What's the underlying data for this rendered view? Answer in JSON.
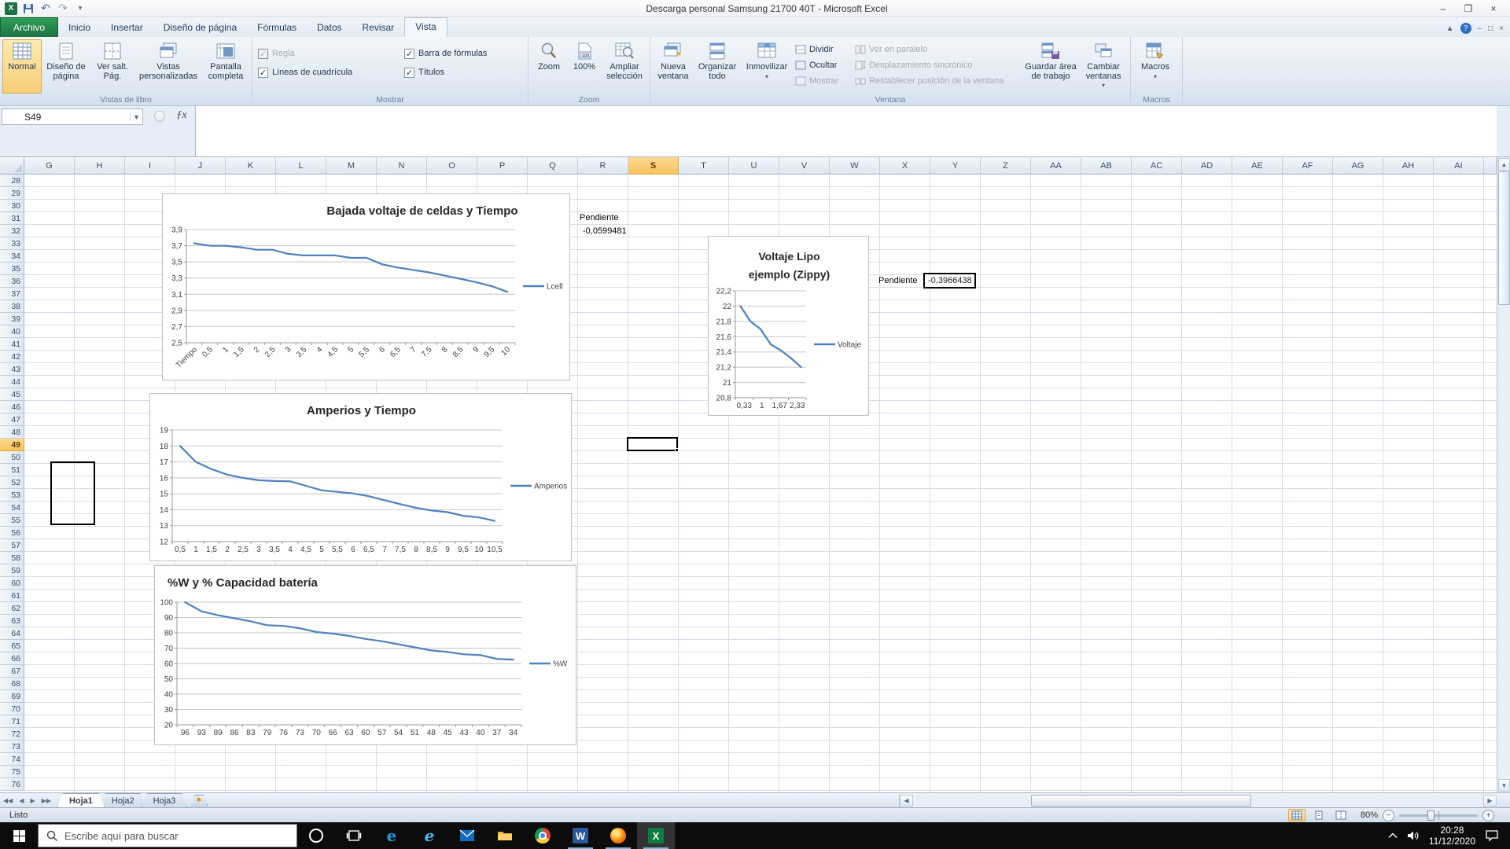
{
  "window": {
    "title": "Descarga personal Samsung 21700 40T - Microsoft Excel"
  },
  "ribbon": {
    "tabs": [
      {
        "label": "Archivo",
        "file": true
      },
      {
        "label": "Inicio"
      },
      {
        "label": "Insertar"
      },
      {
        "label": "Diseño de página"
      },
      {
        "label": "Fórmulas"
      },
      {
        "label": "Datos"
      },
      {
        "label": "Revisar"
      },
      {
        "label": "Vista",
        "active": true
      }
    ],
    "vistas_libro": {
      "label": "Vistas de libro",
      "normal": "Normal",
      "diseno": "Diseño de página",
      "salto": "Ver salt. Pág.",
      "personalizadas": "Vistas personalizadas",
      "pantalla": "Pantalla completa"
    },
    "mostrar": {
      "label": "Mostrar",
      "regla": "Regla",
      "lineas": "Líneas de cuadrícula",
      "barra": "Barra de fórmulas",
      "titulos": "Títulos"
    },
    "zoom": {
      "label": "Zoom",
      "zoom": "Zoom",
      "cien": "100%",
      "ampliar": "Ampliar selección"
    },
    "ventana": {
      "label": "Ventana",
      "nueva": "Nueva ventana",
      "organizar": "Organizar todo",
      "inmovilizar": "Inmovilizar",
      "dividir": "Dividir",
      "ocultar": "Ocultar",
      "mostrar": "Mostrar",
      "paralelo": "Ver en paralelo",
      "desplazamiento": "Desplazamiento sincrónico",
      "restablecer": "Restablecer posición de la ventana",
      "guardar": "Guardar área de trabajo",
      "cambiar": "Cambiar ventanas"
    },
    "macros": {
      "label": "Macros",
      "macros": "Macros"
    }
  },
  "formula_bar": {
    "name_box": "S49",
    "fx": "ƒx"
  },
  "grid": {
    "columns": [
      "G",
      "H",
      "I",
      "J",
      "K",
      "L",
      "M",
      "N",
      "O",
      "P",
      "Q",
      "R",
      "S",
      "T",
      "U",
      "V",
      "W",
      "X",
      "Y",
      "Z",
      "AA",
      "AB",
      "AC",
      "AD",
      "AE",
      "AF",
      "AG",
      "AH",
      "AI"
    ],
    "rows": [
      28,
      29,
      30,
      31,
      32,
      33,
      34,
      35,
      36,
      37,
      38,
      39,
      40,
      41,
      42,
      43,
      44,
      45,
      46,
      47,
      48,
      49,
      50,
      51,
      52,
      53,
      54,
      55,
      56,
      57,
      58,
      59,
      60,
      61,
      62,
      63,
      64,
      65,
      66,
      67,
      68,
      69,
      70,
      71,
      72,
      73,
      74,
      75,
      76
    ],
    "selected_column": "S",
    "selected_row": 49,
    "selected_cell": "S49"
  },
  "cells": {
    "p1_label": "Pendiente",
    "p1_value": "-0,0599481",
    "p2_label": "Pendiente",
    "p2_value": "-0,3966438"
  },
  "chart_data": [
    {
      "type": "line",
      "title": "Bajada voltaje de celdas y Tiempo",
      "legend": "Lcell",
      "color": "#4F81BD",
      "ylim": [
        2.5,
        3.9
      ],
      "yticks": [
        "3,9",
        "3,7",
        "3,5",
        "3,3",
        "3,1",
        "2,9",
        "2,7",
        "2,5"
      ],
      "xlabels": [
        "Tiempo",
        "0,5",
        "1",
        "1,5",
        "2",
        "2,5",
        "3",
        "3,5",
        "4",
        "4,5",
        "5",
        "5,5",
        "6",
        "6,5",
        "7",
        "7,5",
        "8",
        "8,5",
        "9",
        "9,5",
        "10"
      ],
      "values": [
        3.73,
        3.7,
        3.7,
        3.68,
        3.65,
        3.65,
        3.6,
        3.58,
        3.58,
        3.58,
        3.55,
        3.55,
        3.47,
        3.43,
        3.4,
        3.37,
        3.33,
        3.29,
        3.25,
        3.2,
        3.13
      ],
      "legend_position": "right",
      "grid": true
    },
    {
      "type": "line",
      "title": "Voltaje Lipo ejemplo (Zippy)",
      "title_lines": [
        "Voltaje Lipo",
        "ejemplo (Zippy)"
      ],
      "legend": "Voltaje",
      "color": "#4F81BD",
      "ylim": [
        20.8,
        22.2
      ],
      "yticks": [
        "22,2",
        "22",
        "21,8",
        "21,6",
        "21,4",
        "21,2",
        "21",
        "20,8"
      ],
      "xlabels": [
        "0,33",
        "1",
        "1,67",
        "2,33"
      ],
      "values": [
        22.0,
        21.8,
        21.7,
        21.5,
        21.42,
        21.32,
        21.2
      ],
      "legend_position": "right",
      "grid": true
    },
    {
      "type": "line",
      "title": "Amperios y Tiempo",
      "legend": "Amperios",
      "color": "#4F81BD",
      "ylim": [
        12,
        19
      ],
      "yticks": [
        "19",
        "18",
        "17",
        "16",
        "15",
        "14",
        "13",
        "12"
      ],
      "xlabels": [
        "0,5",
        "1",
        "1,5",
        "2",
        "2,5",
        "3",
        "3,5",
        "4",
        "4,5",
        "5",
        "5,5",
        "6",
        "6,5",
        "7",
        "7,5",
        "8",
        "8,5",
        "9",
        "9,5",
        "10",
        "10,5"
      ],
      "values": [
        18.0,
        17.0,
        16.55,
        16.2,
        16.0,
        15.85,
        15.8,
        15.78,
        15.5,
        15.22,
        15.12,
        15.02,
        14.85,
        14.6,
        14.35,
        14.12,
        13.95,
        13.85,
        13.62,
        13.52,
        13.3
      ],
      "legend_position": "right",
      "grid": true
    },
    {
      "type": "line",
      "title": "%W  y % Capacidad batería",
      "legend": "%W",
      "color": "#4F81BD",
      "ylim": [
        20,
        100
      ],
      "yticks": [
        "100",
        "90",
        "80",
        "70",
        "60",
        "50",
        "40",
        "30",
        "20"
      ],
      "xlabels": [
        "96",
        "93",
        "89",
        "86",
        "83",
        "79",
        "76",
        "73",
        "70",
        "66",
        "63",
        "60",
        "57",
        "54",
        "51",
        "48",
        "45",
        "43",
        "40",
        "37",
        "34"
      ],
      "values": [
        100,
        94,
        91.5,
        89.5,
        87.5,
        85,
        84.5,
        83,
        80.5,
        79.5,
        78,
        76,
        74.5,
        72.5,
        70.5,
        68.5,
        67.5,
        66,
        65.5,
        63,
        62.5
      ],
      "legend_position": "right",
      "grid": true
    }
  ],
  "sheet_tabs": {
    "tabs": [
      "Hoja1",
      "Hoja2",
      "Hoja3"
    ],
    "active": "Hoja1"
  },
  "status_bar": {
    "status": "Listo",
    "zoom": "80%"
  },
  "taskbar": {
    "search_placeholder": "Escribe aquí para buscar",
    "icons": [
      {
        "name": "cortana"
      },
      {
        "name": "task-view"
      },
      {
        "name": "edge"
      },
      {
        "name": "ie"
      },
      {
        "name": "mail"
      },
      {
        "name": "explorer"
      },
      {
        "name": "chrome"
      },
      {
        "name": "word",
        "running": true
      },
      {
        "name": "firefox",
        "running": true
      },
      {
        "name": "excel",
        "running": true,
        "active": true
      }
    ],
    "clock_time": "20:28",
    "clock_date": "11/12/2020"
  },
  "colors": {
    "chart_line": "#4F81BD",
    "selected_header": "#f6c45f",
    "archivo_green": "#1e7145",
    "taskbar_underline": "#76b9ed"
  }
}
